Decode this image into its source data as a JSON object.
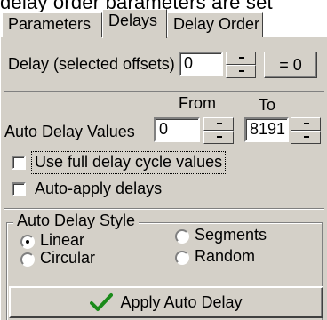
{
  "header_text": "delay order parameters are set",
  "tabs": [
    {
      "label": "Parameters"
    },
    {
      "label": "Delays"
    },
    {
      "label": "Delay Order"
    }
  ],
  "delay_selected": {
    "label": "Delay (selected offsets)",
    "value": "0",
    "zero_button": "= 0"
  },
  "auto_delay": {
    "label": "Auto Delay Values",
    "from_label": "From",
    "to_label": "To",
    "from_value": "0",
    "to_value": "8191"
  },
  "options": {
    "full_cycle_label": "Use full delay cycle values",
    "auto_apply_label": "Auto-apply delays"
  },
  "style_group": {
    "title": "Auto Delay Style",
    "options": [
      "Linear",
      "Segments",
      "Circular",
      "Random"
    ],
    "selected": "Linear"
  },
  "apply_button": {
    "label_prefix": "",
    "label": "Apply Auto Delay"
  },
  "colors": {
    "panel": "#d4d0c8",
    "checkmark": "#1a8a1a"
  }
}
